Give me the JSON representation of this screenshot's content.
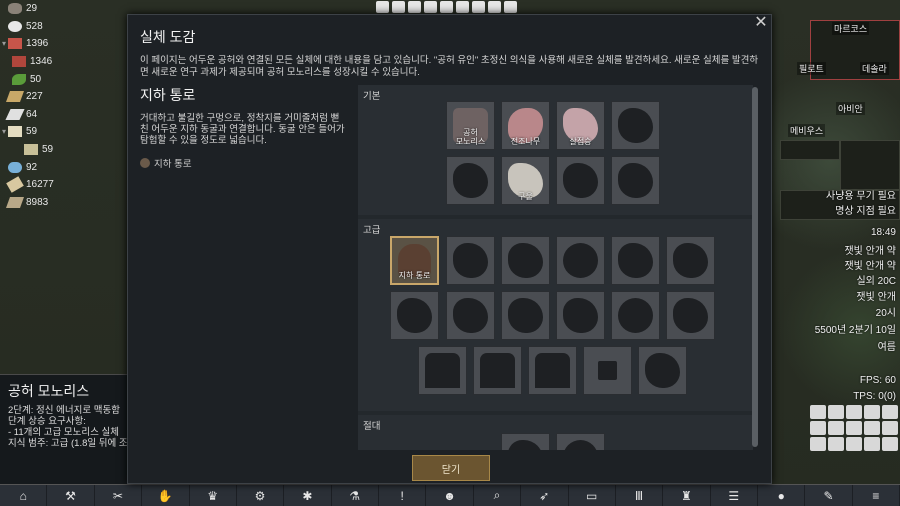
{
  "resources": [
    {
      "value": "29",
      "icon": "rock-chunk-icon",
      "color": "#8a8278",
      "expand": ""
    },
    {
      "value": "528",
      "icon": "meal-icon",
      "color": "#e8e8e8",
      "expand": ""
    },
    {
      "value": "1396",
      "icon": "stone-block-icon",
      "color": "#c8554a",
      "expand": "▾"
    },
    {
      "value": "1346",
      "icon": "stone-block-icon",
      "color": "#b0463c",
      "expand": "",
      "indent": true
    },
    {
      "value": "50",
      "icon": "herb-icon",
      "color": "#5a9c3a",
      "expand": "",
      "indent": true
    },
    {
      "value": "227",
      "icon": "wood-icon",
      "color": "#c8a868",
      "expand": ""
    },
    {
      "value": "64",
      "icon": "cloth-icon",
      "color": "#e0e0e0",
      "expand": ""
    },
    {
      "value": "59",
      "icon": "medicine-icon",
      "color": "#e4dcc0",
      "expand": "▾"
    },
    {
      "value": "59",
      "icon": "medicine-icon",
      "color": "#c8c098",
      "expand": "",
      "indent": true
    },
    {
      "value": "92",
      "icon": "pill-icon",
      "color": "#78b0d8",
      "expand": ""
    },
    {
      "value": "16277",
      "icon": "silver-icon",
      "color": "#d8c8a0",
      "expand": ""
    },
    {
      "value": "8983",
      "icon": "steel-icon",
      "color": "#b8a888",
      "expand": ""
    }
  ],
  "dialog": {
    "title": "실체 도감",
    "description": "이 페이지는 어두운 공허와 연결된 모든 실체에 대한 내용을 담고 있습니다. \"공허 유인\" 초정신 의식을 사용해 새로운 실체를 발견하세요. 새로운 실체를 발견하면 새로운 연구 과제가 제공되며 공허 모노리스를 성장시킬 수 있습니다.",
    "close_label": "닫기",
    "selected": {
      "name": "지하 통로",
      "description": "거대하고 불길한 구멍으로, 정착지를 거미줄처럼 뻗친 어두운 지하 동굴과 연결합니다. 동굴 안은 들어가 탐험할 수 있을 정도로 넓습니다.",
      "link_label": "지하 통로"
    },
    "sections": [
      {
        "label": "기본"
      },
      {
        "label": "고급"
      },
      {
        "label": "절대"
      }
    ],
    "tiles": {
      "basic": [
        "공허\n모노리스",
        "전조나무",
        "살점승",
        "",
        "",
        "구울",
        "",
        ""
      ],
      "advanced_selected": "지하 통로"
    }
  },
  "inspect": {
    "title": "공허 모노리스",
    "lines": [
      "2단계: 정신 에너지로 맥동함",
      "단계 상승 요구사항:",
      "  - 11개의 고급 모노리스 실체",
      "지식 범주: 고급 (1.8일 뒤에 조"
    ],
    "highlight": "1.8일"
  },
  "hud": {
    "messages": [
      "사냥용 무기 필요",
      "명상 지점 필요"
    ],
    "time": "18:49",
    "moods": [
      "잿빛 안개 약",
      "잿빛 안개 약"
    ],
    "temps": [
      "실외 20C",
      "잿빛 안개"
    ],
    "hour": "20시",
    "date": "5500년 2분기 10일",
    "season": "여름",
    "fps": "FPS: 60",
    "tps": "TPS: 0(0)",
    "pawns": [
      "마르코스",
      "필로트",
      "데솔라",
      "아비안",
      "메비우스"
    ]
  },
  "bottombar": {
    "buttons": [
      "house-icon",
      "hammer-icon",
      "scissors-icon",
      "hand-icon",
      "trophy-icon",
      "gear-icon",
      "leaf-icon",
      "flask-icon",
      "alert-icon",
      "pawn-icon",
      "search-icon",
      "wing-icon",
      "book-icon",
      "columns-icon",
      "goblet-icon",
      "list-icon",
      "egg-icon",
      "edit-icon",
      "menu-icon"
    ]
  }
}
